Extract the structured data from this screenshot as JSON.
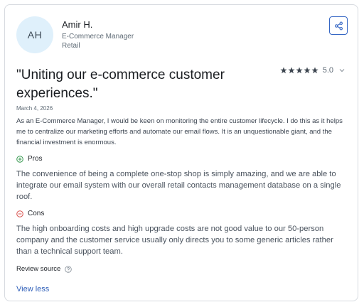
{
  "reviewer": {
    "initials": "AH",
    "name": "Amir H.",
    "role": "E-Commerce Manager",
    "industry": "Retail"
  },
  "review": {
    "title": "\"Uniting our e-commerce customer experiences.\"",
    "rating": "5.0",
    "rating_stars": 5,
    "date": "March 4, 2026",
    "summary": "As an E-Commerce Manager, I would be keen on monitoring the entire customer lifecycle. I do this as it helps me to centralize our marketing efforts and automate our email flows. It is an unquestionable giant, and the financial investment is enormous."
  },
  "pros": {
    "label": "Pros",
    "text": "The convenience of being a complete one-stop shop is simply amazing, and we are able to integrate our email system with our overall retail contacts management database on a single roof."
  },
  "cons": {
    "label": "Cons",
    "text": "The high onboarding costs and high upgrade costs are not good value to our 50-person company and the customer service usually only directs you to some generic articles rather than a technical support team."
  },
  "footer": {
    "review_source_label": "Review source",
    "view_less_label": "View less"
  },
  "icons": {
    "share": "share-icon",
    "star": "star-icon",
    "chevron": "chevron-down-icon",
    "pros": "plus-circle-icon",
    "cons": "minus-circle-icon",
    "help": "question-circle-icon"
  },
  "colors": {
    "accent": "#2f5fb9",
    "pros_green": "#3a9a52",
    "cons_red": "#d9534f",
    "star": "#3d4650",
    "avatar_bg": "#dff0fb"
  }
}
